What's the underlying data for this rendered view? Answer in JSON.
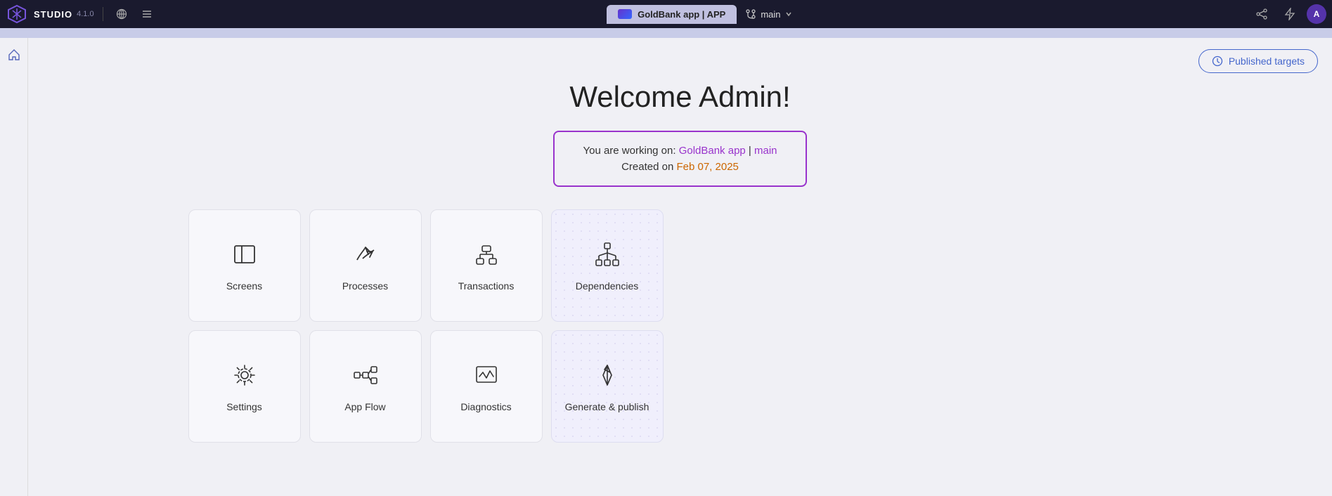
{
  "topbar": {
    "studio_label": "STUDIO",
    "version": "4.1.0",
    "app_tab": "GoldBank app | APP",
    "branch": "main",
    "avatar_initial": "A"
  },
  "published_targets": {
    "label": "Published targets"
  },
  "welcome": {
    "title": "Welcome Admin!",
    "working_on_prefix": "You are working on: ",
    "app_name": "GoldBank app",
    "separator": " | ",
    "branch_name": "main",
    "created_on_prefix": "Created on ",
    "created_date": "Feb 07, 2025"
  },
  "tiles": {
    "row1": [
      {
        "id": "screens",
        "label": "Screens",
        "type": "plain"
      },
      {
        "id": "processes",
        "label": "Processes",
        "type": "plain"
      },
      {
        "id": "transactions",
        "label": "Transactions",
        "type": "plain"
      },
      {
        "id": "dependencies",
        "label": "Dependencies",
        "type": "dotted"
      }
    ],
    "row2": [
      {
        "id": "settings",
        "label": "Settings",
        "type": "plain"
      },
      {
        "id": "app-flow",
        "label": "App Flow",
        "type": "plain"
      },
      {
        "id": "diagnostics",
        "label": "Diagnostics",
        "type": "plain"
      },
      {
        "id": "generate-publish",
        "label": "Generate & publish",
        "type": "dotted"
      }
    ]
  }
}
